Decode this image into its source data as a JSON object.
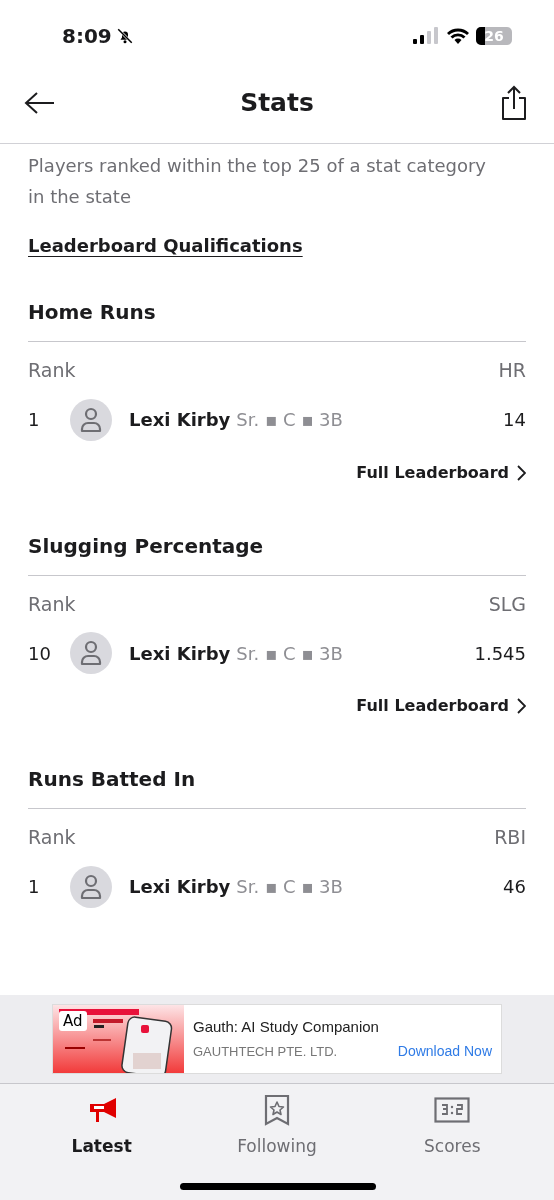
{
  "status_bar": {
    "time": "8:09",
    "battery": "26"
  },
  "header": {
    "title": "Stats"
  },
  "intro": "Players ranked within the top 25 of a stat category in the state",
  "qualifications_link": "Leaderboard Qualifications",
  "sections": [
    {
      "title": "Home Runs",
      "rank_label": "Rank",
      "stat_label": "HR",
      "rows": [
        {
          "rank": "1",
          "name": "Lexi Kirby",
          "details": "Sr. ▪ C ▪ 3B",
          "value": "14"
        }
      ],
      "link": "Full Leaderboard"
    },
    {
      "title": "Slugging Percentage",
      "rank_label": "Rank",
      "stat_label": "SLG",
      "rows": [
        {
          "rank": "10",
          "name": "Lexi Kirby",
          "details": "Sr. ▪ C ▪ 3B",
          "value": "1.545"
        }
      ],
      "link": "Full Leaderboard"
    },
    {
      "title": "Runs Batted In",
      "rank_label": "Rank",
      "stat_label": "RBI",
      "rows": [
        {
          "rank": "1",
          "name": "Lexi Kirby",
          "details": "Sr. ▪ C ▪ 3B",
          "value": "46"
        }
      ]
    }
  ],
  "ad": {
    "badge": "Ad",
    "title": "Gauth: AI Study Companion",
    "advertiser": "GAUTHTECH PTE. LTD.",
    "cta": "Download Now"
  },
  "tabs": [
    {
      "label": "Latest",
      "kind": "latest",
      "selected": true
    },
    {
      "label": "Following",
      "kind": "following",
      "selected": false
    },
    {
      "label": "Scores",
      "kind": "scores",
      "selected": false
    }
  ]
}
